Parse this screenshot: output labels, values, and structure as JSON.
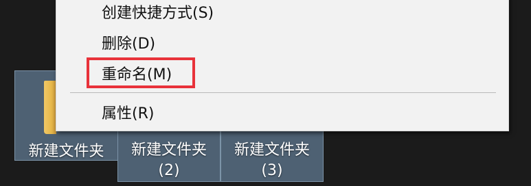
{
  "desktop": {
    "items": [
      {
        "label": "新建文件夹",
        "selected": true
      },
      {
        "label_line1": "新建文件夹",
        "label_line2": "(2)",
        "selected": true
      },
      {
        "label_line1": "新建文件夹",
        "label_line2": "(3)",
        "selected": true
      }
    ],
    "folder_icon": "folder-icon"
  },
  "context_menu": {
    "items": [
      {
        "label": "创建快捷方式(S)"
      },
      {
        "label": "删除(D)"
      },
      {
        "label": "重命名(M)",
        "highlighted": true
      },
      {
        "label": "属性(R)"
      }
    ]
  },
  "colors": {
    "desktop_bg": "#1b1b1b",
    "selection_bg": "#4e6173",
    "selection_border": "#7c94a8",
    "menu_bg": "#f2f2f2",
    "highlight": "#e8323a"
  }
}
